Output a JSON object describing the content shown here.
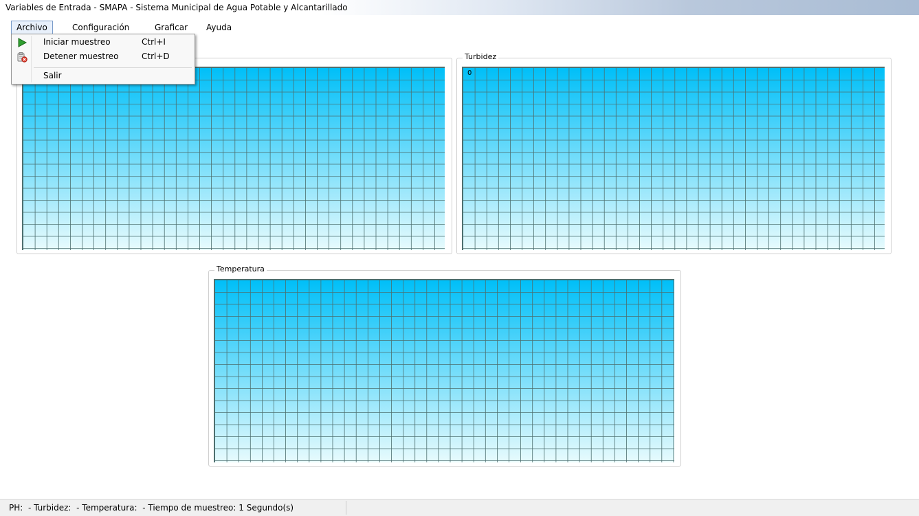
{
  "window": {
    "title": "Variables de Entrada - SMAPA - Sistema Municipal de Agua Potable y Alcantarillado"
  },
  "menubar": {
    "items": [
      {
        "label": "Archivo",
        "active": true
      },
      {
        "label": "Configuración"
      },
      {
        "label": "Graficar"
      },
      {
        "label": "Ayuda"
      }
    ]
  },
  "archivo_menu": {
    "items": [
      {
        "label": "Iniciar muestreo",
        "shortcut": "Ctrl+I",
        "icon": "play-icon"
      },
      {
        "label": "Detener muestreo",
        "shortcut": "Ctrl+D",
        "icon": "stop-sampling-icon"
      },
      {
        "label": "Salir",
        "shortcut": "",
        "icon": ""
      }
    ]
  },
  "panels": {
    "ph": {
      "legend": "",
      "value": ""
    },
    "turbidez": {
      "legend": "Turbidez",
      "value": "0"
    },
    "temperatura": {
      "legend": "Temperatura",
      "value": ""
    }
  },
  "colors": {
    "chart_top": "#00bff8",
    "chart_bottom": "#e8fbfd",
    "grid": "#4d6f6f",
    "accent": "#7a9cc9"
  },
  "statusbar": {
    "ph_label": "PH:",
    "ph_value": "-",
    "turbidez_label": "Turbidez:",
    "turbidez_value": "-",
    "temperatura_label": "Temperatura:",
    "temperatura_value": "-",
    "tiempo_label": "Tiempo de muestreo:",
    "tiempo_value": "1 Segundo(s)"
  }
}
